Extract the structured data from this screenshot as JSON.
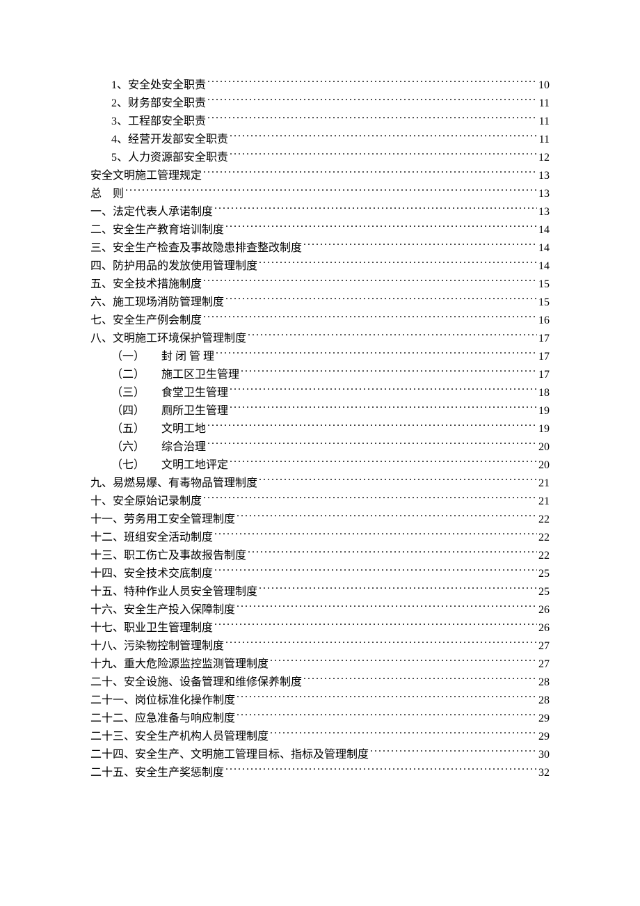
{
  "toc": [
    {
      "level": 1,
      "title": "1、安全处安全职责",
      "page": "10"
    },
    {
      "level": 1,
      "title": "2、财务部安全职责",
      "page": "11"
    },
    {
      "level": 1,
      "title": "3、工程部安全职责",
      "page": "11"
    },
    {
      "level": 1,
      "title": "4、经营开发部安全职责",
      "page": "11"
    },
    {
      "level": 1,
      "title": "5、人力资源部安全职责",
      "page": "12"
    },
    {
      "level": 0,
      "title": "安全文明施工管理规定",
      "page": "13"
    },
    {
      "level": 0,
      "title": "总　则",
      "page": "13"
    },
    {
      "level": 0,
      "title": "一、法定代表人承诺制度",
      "page": "13"
    },
    {
      "level": 0,
      "title": "二、安全生产教育培训制度",
      "page": "14"
    },
    {
      "level": 0,
      "title": "三、安全生产检查及事故隐患排查整改制度",
      "page": "14"
    },
    {
      "level": 0,
      "title": "四、防护用品的发放使用管理制度",
      "page": "14"
    },
    {
      "level": 0,
      "title": "五、安全技术措施制度",
      "page": "15"
    },
    {
      "level": 0,
      "title": "六、施工现场消防管理制度",
      "page": "15"
    },
    {
      "level": 0,
      "title": "七、安全生产例会制度",
      "page": "16"
    },
    {
      "level": 0,
      "title": "八、文明施工环境保护管理制度",
      "page": "17"
    },
    {
      "level": 2,
      "prefix": "（一）",
      "title": "封 闭 管 理",
      "page": "17"
    },
    {
      "level": 2,
      "prefix": "（二）",
      "title": "施工区卫生管理",
      "page": "17"
    },
    {
      "level": 2,
      "prefix": "（三）",
      "title": "食堂卫生管理",
      "page": "18"
    },
    {
      "level": 2,
      "prefix": "（四）",
      "title": "厕所卫生管理",
      "page": "19"
    },
    {
      "level": 2,
      "prefix": "（五）",
      "title": "文明工地",
      "page": "19"
    },
    {
      "level": 2,
      "prefix": "（六）",
      "title": "综合治理",
      "page": "20"
    },
    {
      "level": 2,
      "prefix": "（七）",
      "title": "文明工地评定",
      "page": "20"
    },
    {
      "level": 0,
      "title": "九、易燃易爆、有毒物品管理制度",
      "page": "21"
    },
    {
      "level": 0,
      "title": "十、安全原始记录制度",
      "page": "21"
    },
    {
      "level": 0,
      "title": "十一、劳务用工安全管理制度",
      "page": "22"
    },
    {
      "level": 0,
      "title": "十二、班组安全活动制度",
      "page": "22"
    },
    {
      "level": 0,
      "title": "十三、职工伤亡及事故报告制度",
      "page": "22"
    },
    {
      "level": 0,
      "title": "十四、安全技术交底制度",
      "page": "25"
    },
    {
      "level": 0,
      "title": "十五、特种作业人员安全管理制度",
      "page": "25"
    },
    {
      "level": 0,
      "title": "十六、安全生产投入保障制度",
      "page": "26"
    },
    {
      "level": 0,
      "title": "十七、职业卫生管理制度",
      "page": "26"
    },
    {
      "level": 0,
      "title": "十八、污染物控制管理制度",
      "page": "27"
    },
    {
      "level": 0,
      "title": "十九、重大危险源监控监测管理制度",
      "page": "27"
    },
    {
      "level": 0,
      "title": "二十、安全设施、设备管理和维修保养制度",
      "page": "28"
    },
    {
      "level": 0,
      "title": "二十一、岗位标准化操作制度",
      "page": "28"
    },
    {
      "level": 0,
      "title": "二十二、应急准备与响应制度",
      "page": "29"
    },
    {
      "level": 0,
      "title": "二十三、安全生产机构人员管理制度",
      "page": "29"
    },
    {
      "level": 0,
      "title": "二十四、安全生产、文明施工管理目标、指标及管理制度",
      "page": "30"
    },
    {
      "level": 0,
      "title": "二十五、安全生产奖惩制度",
      "page": "32"
    }
  ]
}
